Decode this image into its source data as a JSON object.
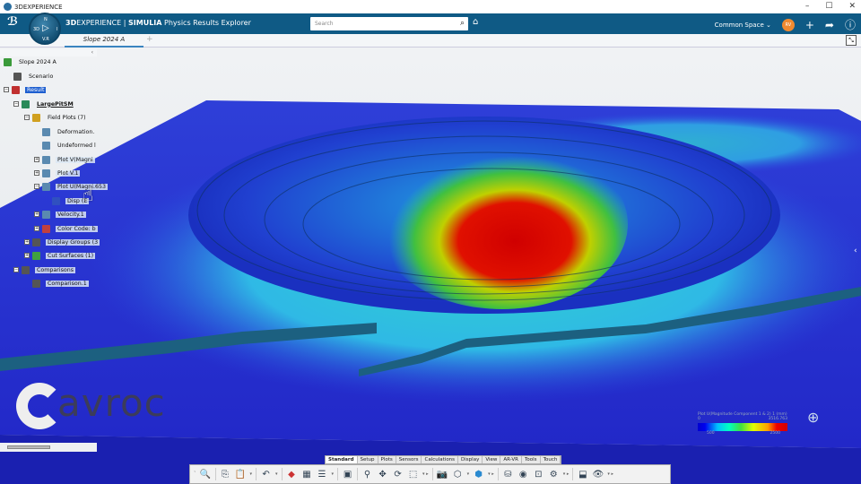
{
  "window": {
    "title": "3DEXPERIENCE",
    "controls": [
      "–",
      "☐",
      "✕"
    ]
  },
  "header": {
    "brand_bold": "3D",
    "brand_rest": "EXPERIENCE | ",
    "app_bold": "SIMULIA",
    "app_rest": " Physics Results Explorer",
    "compass": {
      "top": "N",
      "left": "3D",
      "right": "I",
      "bottom": "V.R"
    },
    "search_placeholder": "Search",
    "space": "Common Space",
    "avatar": "RV"
  },
  "tabs": {
    "active": "Slope 2024 A",
    "add": "+"
  },
  "tree": [
    {
      "label": "Slope 2024 A",
      "color": "#3a9a3a"
    },
    {
      "label": "Scenario",
      "color": "#555"
    },
    {
      "label": "Result",
      "color": "#c03030"
    },
    {
      "label": "LargePitSM",
      "color": "#2a8a5a"
    },
    {
      "label": "Field Plots (7)",
      "color": "#d0a020"
    },
    {
      "label": "Deformation.",
      "color": "#5a8ab0"
    },
    {
      "label": "Undeformed l",
      "color": "#5a8ab0"
    },
    {
      "label": "Plot V(Magni",
      "color": "#5a8ab0"
    },
    {
      "label": "Plot V.1",
      "color": "#5a8ab0"
    },
    {
      "label": "Plot U(Magni.653",
      "color": "#5a8ab0"
    },
    {
      "label": "Disp (E",
      "color": "#3050c0"
    },
    {
      "label": "Velocity.1",
      "color": "#5a8ab0"
    },
    {
      "label": "Color Code: b",
      "color": "#c04040"
    },
    {
      "label": "Display Groups (3",
      "color": "#555"
    },
    {
      "label": "Cut Surfaces (1)",
      "color": "#40a040"
    },
    {
      "label": "Comparisons",
      "color": "#555"
    },
    {
      "label": "Comparison.1",
      "color": "#555"
    }
  ],
  "watermark": "avroc",
  "legend": {
    "title": "Plot U(Magnitude Component 1 & 2) 1 (mm)",
    "min": "0",
    "max": "3516.763",
    "tick1": "500",
    "tick2": "2500"
  },
  "toolbar_tabs": [
    "Standard",
    "Setup",
    "Plots",
    "Sensors",
    "Calculations",
    "Display",
    "View",
    "AR-VR",
    "Tools",
    "Touch"
  ],
  "toolbar_active": "Standard"
}
